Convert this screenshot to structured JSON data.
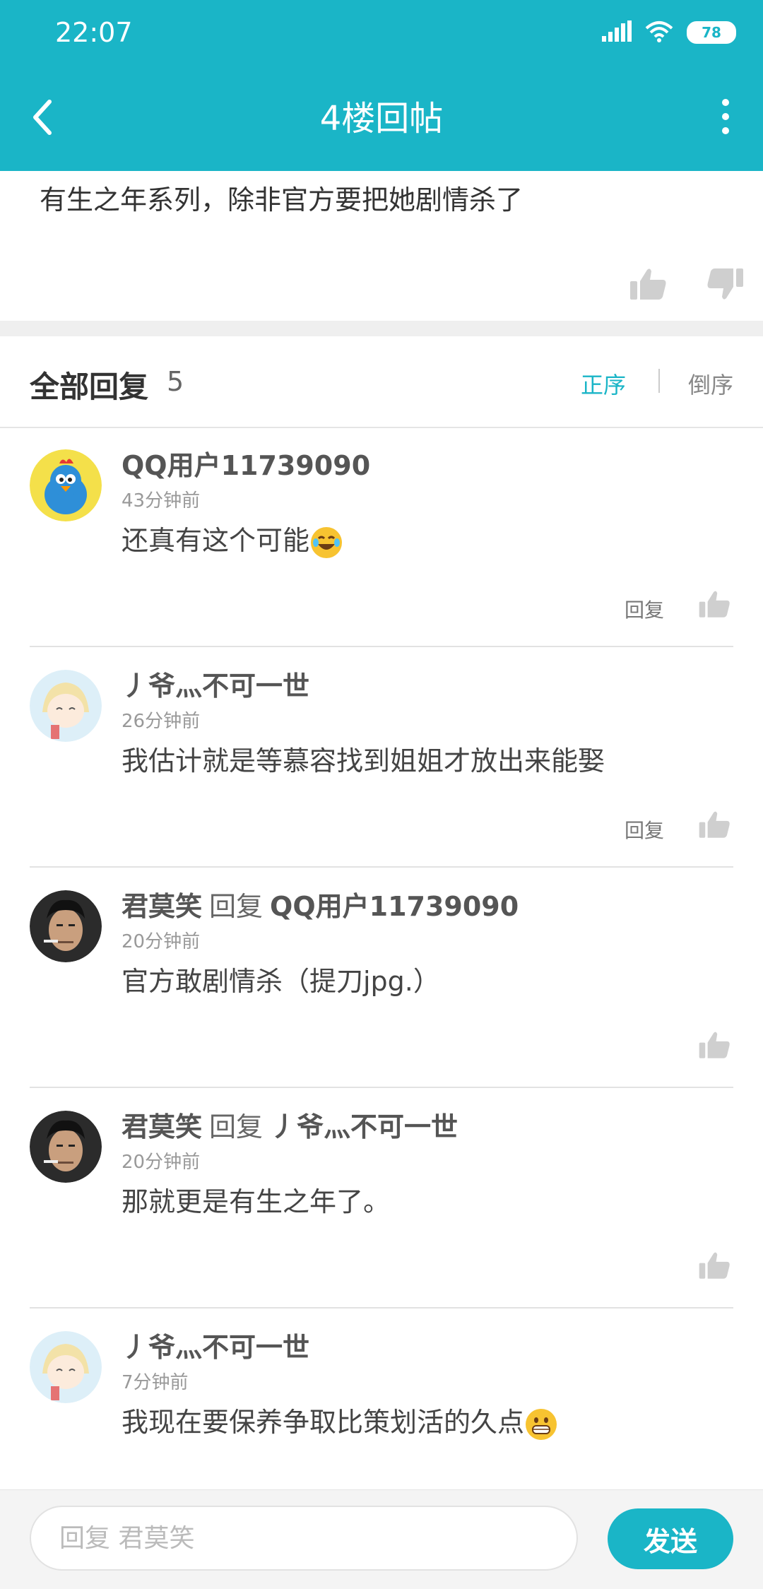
{
  "status_bar": {
    "time": "22:07",
    "battery": "78",
    "icons": [
      "signal-icon",
      "wifi-icon",
      "battery-icon"
    ]
  },
  "nav": {
    "title": "4楼回帖",
    "back_icon": "back-arrow-icon",
    "more_icon": "more-vertical-icon"
  },
  "post": {
    "text": "有生之年系列，除非官方要把她剧情杀了"
  },
  "section": {
    "title": "全部回复",
    "count": "5",
    "sort_forward": "正序",
    "sort_reverse": "倒序"
  },
  "comments": [
    {
      "user": "QQ用户11739090",
      "reply_word": "",
      "reply_to": "",
      "time": "43分钟前",
      "text": "还真有这个可能",
      "emoji": "laughing-tears-emoji",
      "reply_label": "回复"
    },
    {
      "user": "丿爷灬不可一世",
      "reply_word": "",
      "reply_to": "",
      "time": "26分钟前",
      "text": "我估计就是等慕容找到姐姐才放出来能娶",
      "reply_label": "回复"
    },
    {
      "user": "君莫笑",
      "reply_word": "回复",
      "reply_to": "QQ用户11739090",
      "time": "20分钟前",
      "text": "官方敢剧情杀（提刀jpg.）",
      "reply_label": ""
    },
    {
      "user": "君莫笑",
      "reply_word": "回复",
      "reply_to": "丿爷灬不可一世",
      "time": "20分钟前",
      "text": "那就更是有生之年了。",
      "reply_label": ""
    },
    {
      "user": "丿爷灬不可一世",
      "reply_word": "",
      "reply_to": "",
      "time": "7分钟前",
      "text": "我现在要保养争取比策划活的久点",
      "emoji": "grinning-emoji",
      "reply_label": ""
    }
  ],
  "input": {
    "placeholder": "回复 君莫笑",
    "send_label": "发送"
  },
  "colors": {
    "accent": "#1AB5C7",
    "background": "#ffffff",
    "divider": "#efefef"
  }
}
